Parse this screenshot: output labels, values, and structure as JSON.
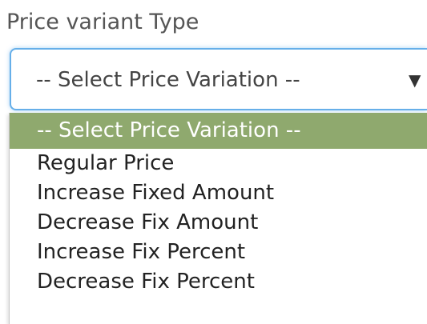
{
  "label": "Price variant Type",
  "select": {
    "value": "-- Select Price Variation --",
    "caret_icon": "caret-down-icon",
    "focus_border_color": "#66afe9"
  },
  "dropdown": {
    "highlight_color": "#8fa96e",
    "options": [
      "-- Select Price Variation --",
      "Regular Price",
      "Increase Fixed Amount",
      "Decrease Fix Amount",
      "Increase Fix Percent",
      "Decrease Fix Percent"
    ]
  }
}
